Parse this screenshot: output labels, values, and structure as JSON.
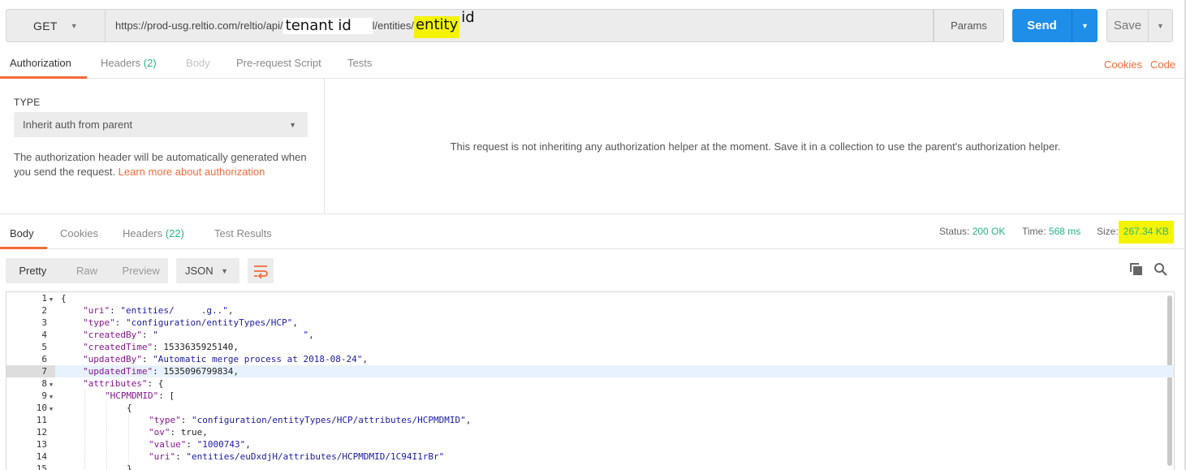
{
  "request": {
    "method": "GET",
    "url_base": "https://prod-usg.reltio.com/reltio/api/",
    "url_tenant_overlay": "tenant id",
    "url_mid": "l/entities/",
    "url_entity_overlay": "entity",
    "url_entity_tail": "id",
    "params_label": "Params",
    "send_label": "Send",
    "save_label": "Save"
  },
  "request_tabs": {
    "authorization": "Authorization",
    "headers": "Headers",
    "headers_count": "(2)",
    "body": "Body",
    "prerequest": "Pre-request Script",
    "tests": "Tests",
    "cookies": "Cookies",
    "code": "Code"
  },
  "auth": {
    "type_label": "TYPE",
    "type_value": "Inherit auth from parent",
    "description": "The authorization header will be automatically generated when you send the request. ",
    "learn_more": "Learn more about authorization",
    "info": "This request is not inheriting any authorization helper at the moment. Save it in a collection to use the parent's authorization helper."
  },
  "response_tabs": {
    "body": "Body",
    "cookies": "Cookies",
    "headers": "Headers",
    "headers_count": "(22)",
    "test_results": "Test Results"
  },
  "response_status": {
    "status_label": "Status:",
    "status_value": "200 OK",
    "time_label": "Time:",
    "time_value": "568 ms",
    "size_label": "Size:",
    "size_value": "267.34 KB"
  },
  "body_toolbar": {
    "pretty": "Pretty",
    "raw": "Raw",
    "preview": "Preview",
    "format": "JSON",
    "wrap_icon": "wrap-lines-icon",
    "copy_icon": "copy-icon",
    "search_icon": "search-icon"
  },
  "colors": {
    "accent_orange": "#f26b3a",
    "send_blue": "#1e8ee8",
    "status_green": "#26b47f",
    "highlight_yellow": "#f4f400"
  },
  "code_lines": [
    {
      "n": "1",
      "fold": true,
      "indent": 0,
      "parts": [
        [
          "n",
          "{"
        ]
      ]
    },
    {
      "n": "2",
      "fold": false,
      "indent": 1,
      "parts": [
        [
          "k",
          "\"uri\""
        ],
        [
          "n",
          ": "
        ],
        [
          "s",
          "\"entities/     .g..\""
        ],
        [
          "n",
          ","
        ]
      ]
    },
    {
      "n": "3",
      "fold": false,
      "indent": 1,
      "parts": [
        [
          "k",
          "\"type\""
        ],
        [
          "n",
          ": "
        ],
        [
          "s",
          "\"configuration/entityTypes/HCP\""
        ],
        [
          "n",
          ","
        ]
      ]
    },
    {
      "n": "4",
      "fold": false,
      "indent": 1,
      "parts": [
        [
          "k",
          "\"createdBy\""
        ],
        [
          "n",
          ": "
        ],
        [
          "s",
          "\"                           \""
        ],
        [
          "n",
          ","
        ]
      ]
    },
    {
      "n": "5",
      "fold": false,
      "indent": 1,
      "parts": [
        [
          "k",
          "\"createdTime\""
        ],
        [
          "n",
          ": 1533635925140,"
        ]
      ]
    },
    {
      "n": "6",
      "fold": false,
      "indent": 1,
      "parts": [
        [
          "k",
          "\"updatedBy\""
        ],
        [
          "n",
          ": "
        ],
        [
          "s",
          "\"Automatic merge process at 2018-08-24\""
        ],
        [
          "n",
          ","
        ]
      ]
    },
    {
      "n": "7",
      "fold": false,
      "indent": 1,
      "hl": true,
      "parts": [
        [
          "k",
          "\"updatedTime\""
        ],
        [
          "n",
          ": 1535096799834,"
        ]
      ]
    },
    {
      "n": "8",
      "fold": true,
      "indent": 1,
      "parts": [
        [
          "k",
          "\"attributes\""
        ],
        [
          "n",
          ": {"
        ]
      ]
    },
    {
      "n": "9",
      "fold": true,
      "indent": 2,
      "parts": [
        [
          "k",
          "\"HCPMDMID\""
        ],
        [
          "n",
          ": ["
        ]
      ]
    },
    {
      "n": "10",
      "fold": true,
      "indent": 3,
      "parts": [
        [
          "n",
          "{"
        ]
      ]
    },
    {
      "n": "11",
      "fold": false,
      "indent": 4,
      "parts": [
        [
          "k",
          "\"type\""
        ],
        [
          "n",
          ": "
        ],
        [
          "s",
          "\"configuration/entityTypes/HCP/attributes/HCPMDMID\""
        ],
        [
          "n",
          ","
        ]
      ]
    },
    {
      "n": "12",
      "fold": false,
      "indent": 4,
      "parts": [
        [
          "k",
          "\"ov\""
        ],
        [
          "n",
          ": true,"
        ]
      ]
    },
    {
      "n": "13",
      "fold": false,
      "indent": 4,
      "parts": [
        [
          "k",
          "\"value\""
        ],
        [
          "n",
          ": "
        ],
        [
          "s",
          "\"1000743\""
        ],
        [
          "n",
          ","
        ]
      ]
    },
    {
      "n": "14",
      "fold": false,
      "indent": 4,
      "parts": [
        [
          "k",
          "\"uri\""
        ],
        [
          "n",
          ": "
        ],
        [
          "s",
          "\"entities/euDxdjH/attributes/HCPMDMID/1C94I1rBr\""
        ]
      ]
    },
    {
      "n": "15",
      "fold": false,
      "indent": 3,
      "parts": [
        [
          "n",
          "},"
        ]
      ]
    }
  ]
}
